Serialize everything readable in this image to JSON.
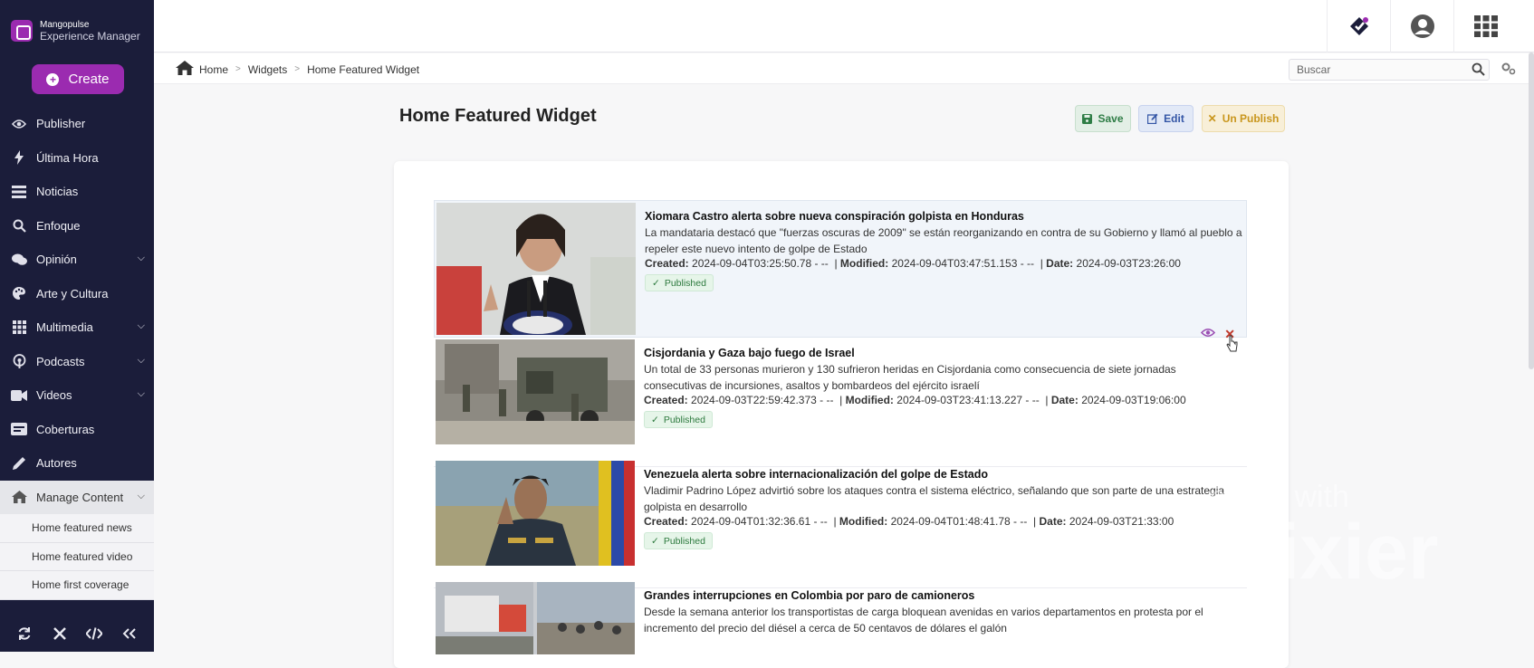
{
  "app": {
    "brand_line1": "Mangopulse",
    "brand_line2": "Experience Manager"
  },
  "sidebar": {
    "create_label": "Create",
    "items": [
      {
        "label": "Publisher",
        "icon": "eye-icon"
      },
      {
        "label": "Última Hora",
        "icon": "bolt-icon"
      },
      {
        "label": "Noticias",
        "icon": "list-icon"
      },
      {
        "label": "Enfoque",
        "icon": "search-icon"
      },
      {
        "label": "Opinión",
        "icon": "comments-icon",
        "chevron": true
      },
      {
        "label": "Arte y Cultura",
        "icon": "palette-icon"
      },
      {
        "label": "Multimedia",
        "icon": "grid-icon",
        "chevron": true
      },
      {
        "label": "Podcasts",
        "icon": "podcast-icon",
        "chevron": true
      },
      {
        "label": "Videos",
        "icon": "video-icon",
        "chevron": true
      },
      {
        "label": "Coberturas",
        "icon": "coverage-icon"
      },
      {
        "label": "Autores",
        "icon": "pen-icon"
      },
      {
        "label": "Manage Content",
        "icon": "home-icon",
        "chevron": true
      }
    ],
    "subitems": [
      "Home featured news",
      "Home featured video",
      "Home first coverage"
    ]
  },
  "breadcrumb": {
    "home": "Home",
    "widgets": "Widgets",
    "current": "Home Featured Widget"
  },
  "search": {
    "placeholder": "Buscar"
  },
  "page": {
    "title": "Home Featured Widget",
    "save_label": "Save",
    "edit_label": "Edit",
    "unpublish_label": "Un Publish"
  },
  "labels": {
    "created": "Created:",
    "modified": "Modified:",
    "date": "Date:"
  },
  "articles": [
    {
      "title": "Xiomara Castro alerta sobre nueva conspiración golpista en Honduras",
      "summary": "La mandataria destacó que \"fuerzas oscuras de 2009\" se están reorganizando en contra de su Gobierno y llamó al pueblo a repeler este nuevo intento de golpe de Estado",
      "created": "2024-09-04T03:25:50.78 - --",
      "modified": "2024-09-04T03:47:51.153 - --",
      "date": "2024-09-03T23:26:00",
      "status": "Published"
    },
    {
      "title": "Cisjordania y Gaza bajo fuego de Israel",
      "summary": "Un total de 33 personas murieron y 130 sufrieron heridas en Cisjordania como consecuencia de siete jornadas consecutivas de incursiones, asaltos y bombardeos del ejército israelí",
      "created": "2024-09-03T22:59:42.373 - --",
      "modified": "2024-09-03T23:41:13.227 - --",
      "date": "2024-09-03T19:06:00",
      "status": "Published"
    },
    {
      "title": "Venezuela alerta sobre internacionalización del golpe de Estado",
      "summary": "Vladimir Padrino López advirtió sobre los ataques contra el sistema eléctrico, señalando que son parte de una estrategia golpista en desarrollo",
      "created": "2024-09-04T01:32:36.61 - --",
      "modified": "2024-09-04T01:48:41.78 - --",
      "date": "2024-09-03T21:33:00",
      "status": "Published"
    },
    {
      "title": "Grandes interrupciones en Colombia por paro de camioneros",
      "summary": "Desde la semana anterior los transportistas de carga bloquean avenidas en varios departamentos en protesta por el incremento del precio del diésel a cerca de 50 centavos de dólares el galón",
      "created": "",
      "modified": "",
      "date": "",
      "status": ""
    }
  ],
  "watermark": {
    "line1": "made with",
    "line2": "Flixier"
  }
}
